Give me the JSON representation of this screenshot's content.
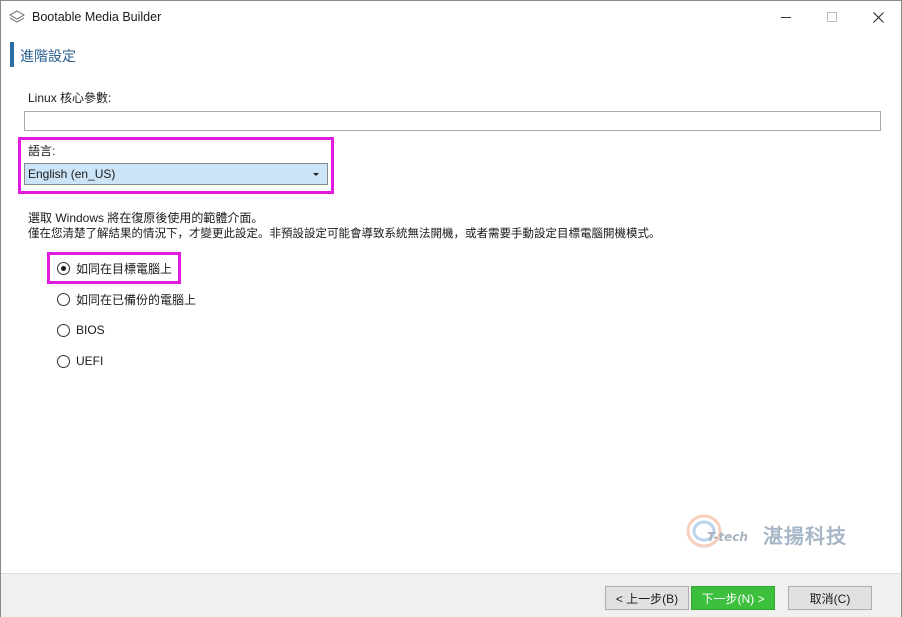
{
  "window": {
    "title": "Bootable Media Builder",
    "icon": "layers-icon"
  },
  "section": {
    "title": "進階設定"
  },
  "kernel": {
    "label": "Linux 核心參數:",
    "value": ""
  },
  "language": {
    "label": "語言:",
    "selected": "English (en_US)"
  },
  "windows_mode": {
    "desc_line1": "選取 Windows 將在復原後使用的範體介面。",
    "desc_line2": "僅在您清楚了解結果的情況下，才變更此設定。非預設設定可能會導致系統無法開機，或者需要手動設定目標電腦開機模式。",
    "options": [
      {
        "label": "如同在目標電腦上",
        "checked": true
      },
      {
        "label": "如同在已備份的電腦上",
        "checked": false
      },
      {
        "label": "BIOS",
        "checked": false
      },
      {
        "label": "UEFI",
        "checked": false
      }
    ]
  },
  "watermark": {
    "tech": "T-tech",
    "brand": "湛揚科技"
  },
  "footer": {
    "back_label": "< 上一步(B)",
    "next_label": "下一步(N) >",
    "cancel_label": "取消(C)"
  },
  "colors": {
    "highlight": "#e01ae0",
    "accent": "#2c6ea8",
    "next_button": "#3cbf3c",
    "select_bg": "#cce4f7"
  }
}
